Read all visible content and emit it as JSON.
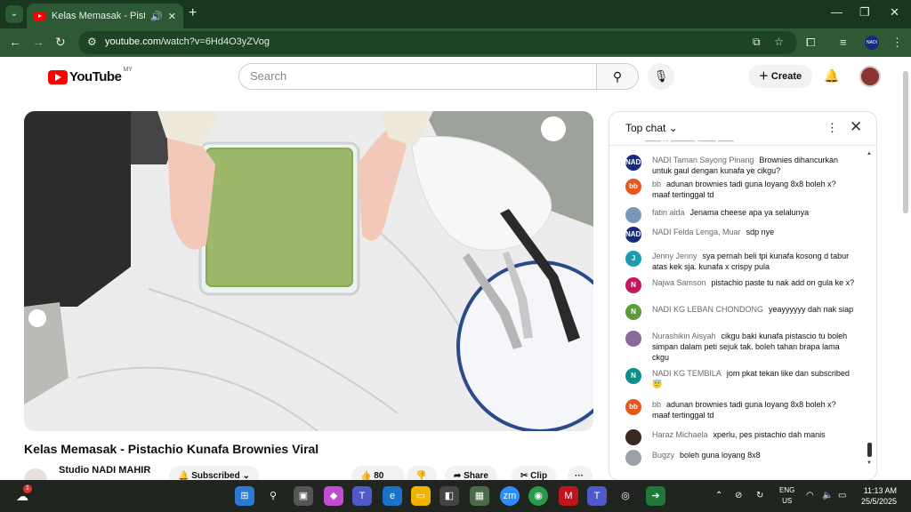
{
  "browser": {
    "tab_title": "Kelas Memasak - Pistachio K",
    "url_domain": "youtube.com",
    "url_path": "/watch?v=6Hd4O3yZVog",
    "profile_label": "NADI"
  },
  "youtube": {
    "logo_text": "YouTube",
    "country_code": "MY",
    "search_placeholder": "Search",
    "create_label": "Create"
  },
  "video": {
    "title": "Kelas Memasak - Pistachio Kunafa Brownies Viral",
    "channel": "Studio NADI MAHIR",
    "subscribed_label": "Subscribed",
    "likes": "80",
    "share_label": "Share",
    "clip_label": "Clip"
  },
  "chat": {
    "header": "Top chat",
    "messages": [
      {
        "author": "NADI Taman Sayong Pinang",
        "text": "Brownies dihancurkan untuk gaul dengan kunafa ye cikgu?",
        "avatar": "NADI",
        "color": "#1a2a7a"
      },
      {
        "author": "bb",
        "text": "adunan brownies tadi guna loyang 8x8 boleh x? maaf tertinggal td",
        "avatar": "bb",
        "color": "#e8571c"
      },
      {
        "author": "fatin aida",
        "text": "Jenama cheese apa ya selalunya",
        "avatar": "",
        "color": "#7a96b8"
      },
      {
        "author": "NADI Felda Lenga, Muar",
        "text": "sdp nye",
        "avatar": "NADI",
        "color": "#1a2a7a"
      },
      {
        "author": "Jenny Jenny",
        "text": "sya pernah beli tpi kunafa kosong d tabur atas kek sja. kunafa x crispy pula",
        "avatar": "J",
        "color": "#1e9ab0"
      },
      {
        "author": "Najwa Samson",
        "text": "pistachio paste tu nak add on gula ke x?",
        "avatar": "N",
        "color": "#c2185b"
      },
      {
        "author": "NADI KG LEBAN CHONDONG",
        "text": "yeayyyyyy dah nak siap",
        "avatar": "N",
        "color": "#5d9a3a"
      },
      {
        "author": "Nurashikin Aisyah",
        "text": "cikgu baki kunafa pistascio tu boleh simpan dalam peti sejuk tak. boleh tahan brapa lama ckgu",
        "avatar": "",
        "color": "#8a6a9a"
      },
      {
        "author": "NADI KG TEMBILA",
        "text": "jom pkat tekan like dan subscribed 😇",
        "avatar": "N",
        "color": "#0c8f8a"
      },
      {
        "author": "bb",
        "text": "adunan brownies tadi guna loyang 8x8 boleh x? maaf tertinggal td",
        "avatar": "bb",
        "color": "#e8571c"
      },
      {
        "author": "Haraz Michaela",
        "text": "xperlu, pes pistachio dah manis",
        "avatar": "",
        "color": "#3a2a22"
      },
      {
        "author": "Bugzy",
        "text": "boleh guna loyang 8x8",
        "avatar": "",
        "color": "#9aa0a6"
      }
    ]
  },
  "taskbar": {
    "lang_top": "ENG",
    "lang_bottom": "US",
    "time": "11:13 AM",
    "date": "25/5/2025",
    "weather_badge": "1",
    "zoom_label": "zm"
  }
}
